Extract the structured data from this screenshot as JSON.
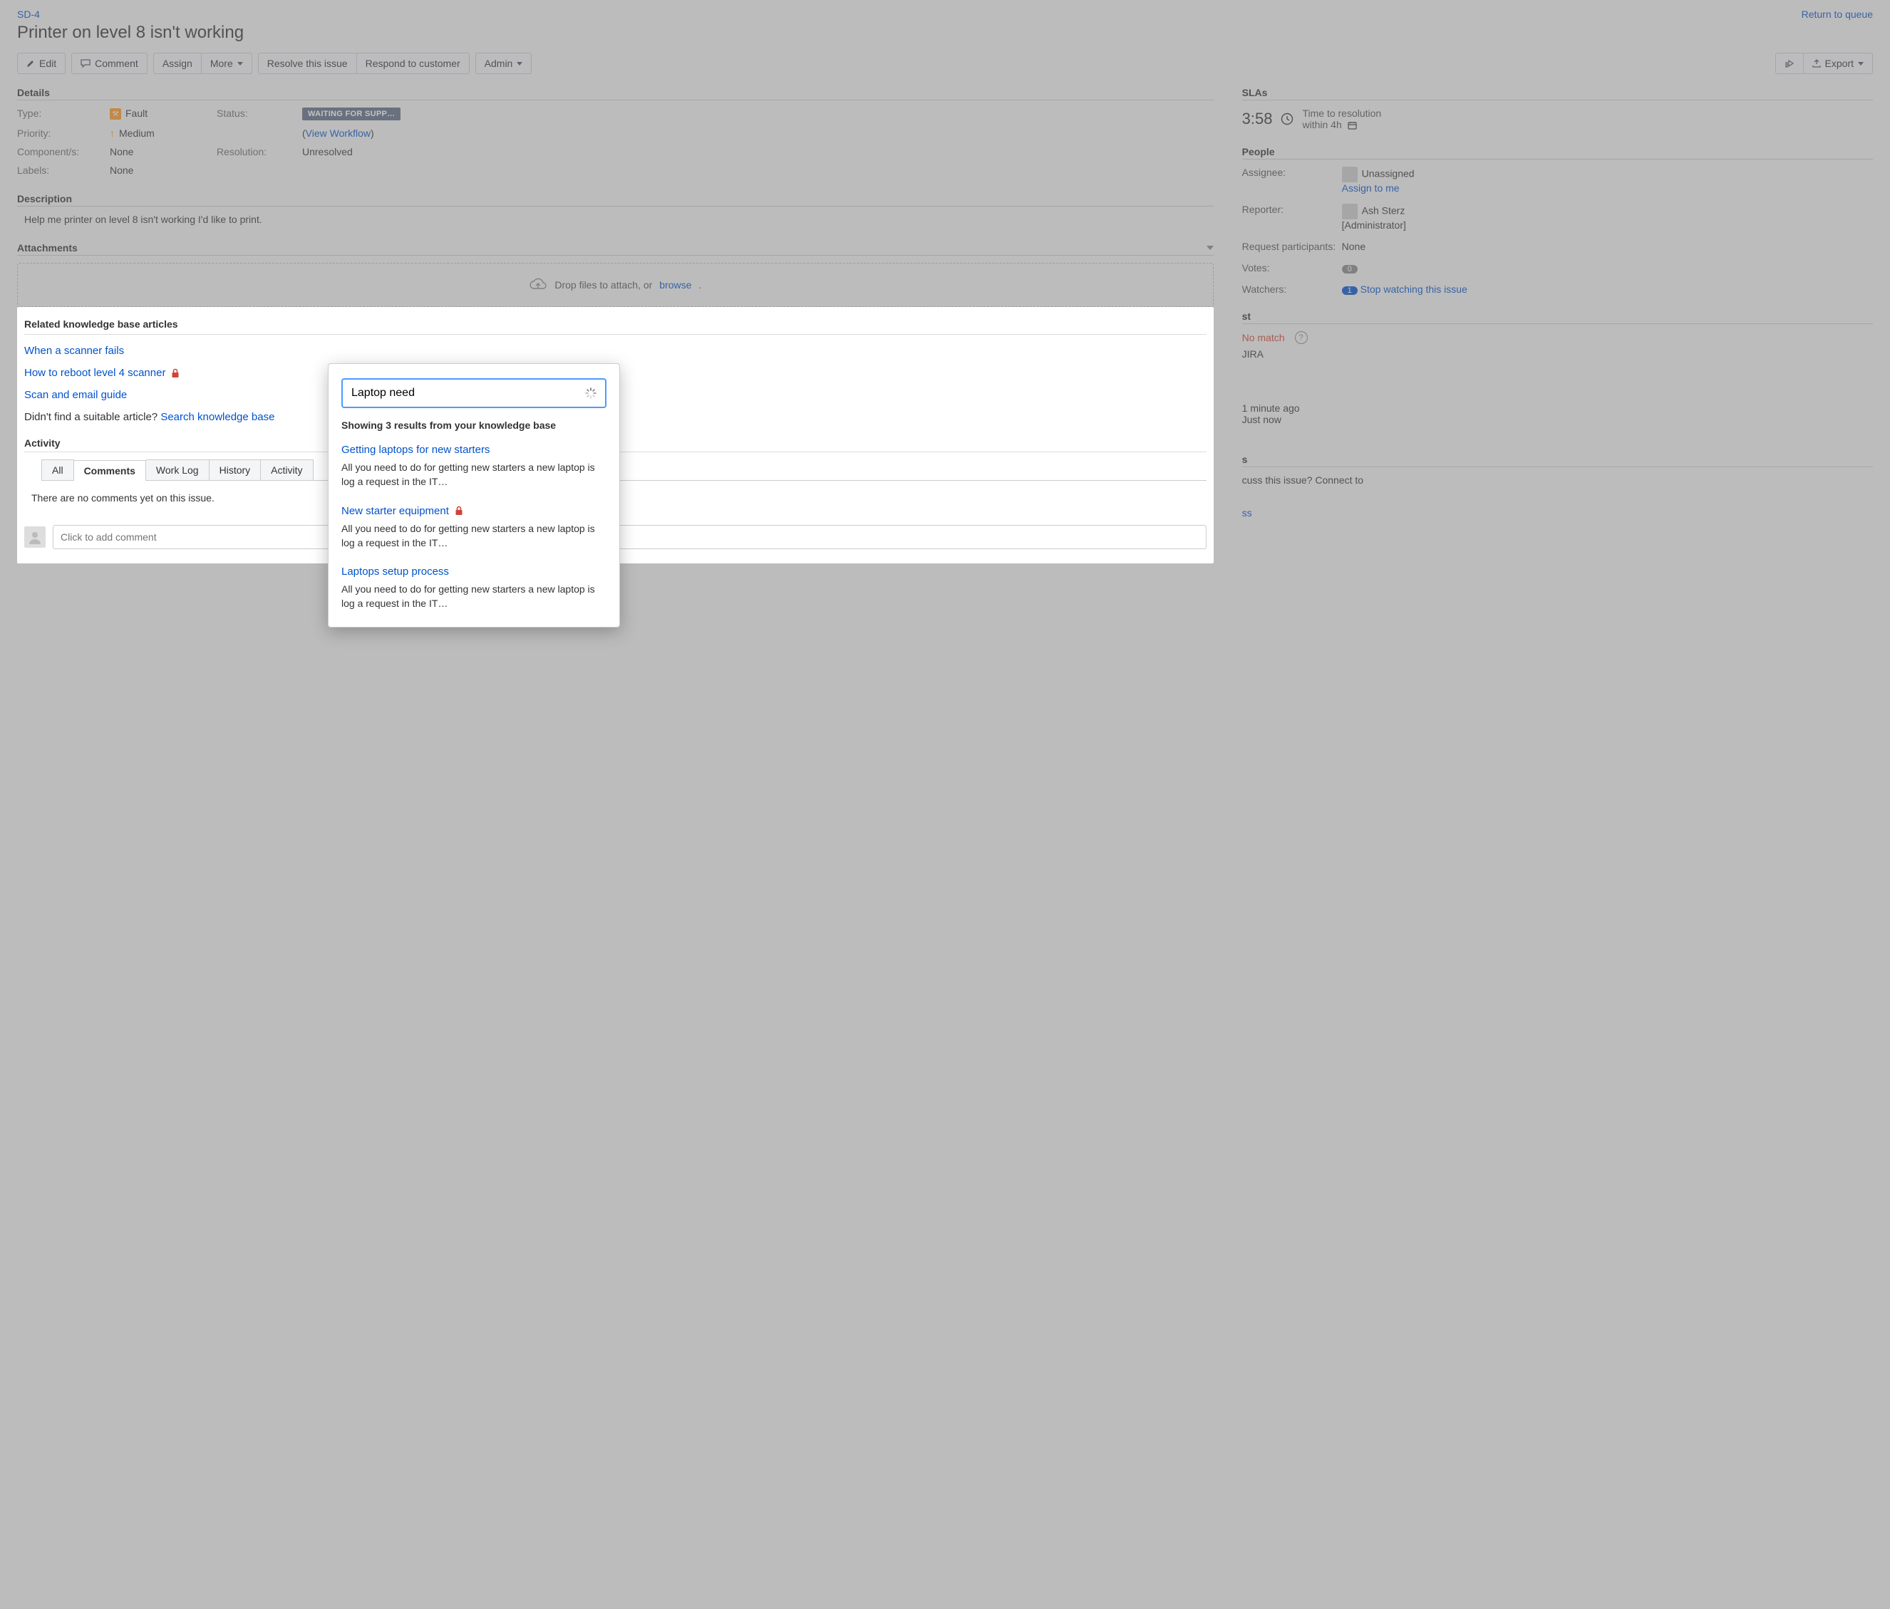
{
  "header": {
    "issue_key": "SD-4",
    "return_link": "Return to queue",
    "title": "Printer on level 8 isn't working"
  },
  "toolbar": {
    "edit": "Edit",
    "comment": "Comment",
    "assign": "Assign",
    "more": "More",
    "resolve": "Resolve this issue",
    "respond": "Respond to customer",
    "admin": "Admin",
    "export": "Export"
  },
  "details": {
    "heading": "Details",
    "type_label": "Type:",
    "type_value": "Fault",
    "status_label": "Status:",
    "status_value": "WAITING FOR SUPP…",
    "workflow_link": "View Workflow",
    "priority_label": "Priority:",
    "priority_value": "Medium",
    "components_label": "Component/s:",
    "components_value": "None",
    "resolution_label": "Resolution:",
    "resolution_value": "Unresolved",
    "labels_label": "Labels:",
    "labels_value": "None"
  },
  "description": {
    "heading": "Description",
    "text": "Help me printer on level 8 isn't working I'd like to print."
  },
  "attachments": {
    "heading": "Attachments",
    "drop_text": "Drop files to attach, or",
    "browse": "browse"
  },
  "kb": {
    "heading": "Related knowledge base articles",
    "items": [
      {
        "title": "When a scanner fails",
        "locked": false
      },
      {
        "title": "How to reboot level 4 scanner",
        "locked": true
      },
      {
        "title": "Scan and email guide",
        "locked": false
      }
    ],
    "prompt_prefix": "Didn't find a suitable article? ",
    "prompt_link": "Search knowledge base"
  },
  "activity": {
    "heading": "Activity",
    "tabs": {
      "all": "All",
      "comments": "Comments",
      "worklog": "Work Log",
      "history": "History",
      "activity": "Activity"
    },
    "empty": "There are no comments yet on this issue.",
    "placeholder": "Click to add comment"
  },
  "sla": {
    "heading": "SLAs",
    "time": "3:58",
    "label": "Time to resolution",
    "within": "within 4h"
  },
  "people": {
    "heading": "People",
    "assignee_label": "Assignee:",
    "assignee_value": "Unassigned",
    "assign_to_me": "Assign to me",
    "reporter_label": "Reporter:",
    "reporter_value": "Ash Sterz",
    "reporter_role": "[Administrator]",
    "participants_label": "Request participants:",
    "participants_value": "None",
    "votes_label": "Votes:",
    "votes_value": "0",
    "watchers_label": "Watchers:",
    "watchers_count": "1",
    "watchers_link": "Stop watching this issue"
  },
  "request": {
    "heading_tail": "st",
    "nomatch": "No match",
    "jira": "JIRA",
    "t1": "1 minute ago",
    "t2": "Just now",
    "tail_s": "s",
    "connect_tail": "cuss this issue? Connect to",
    "ss": "ss"
  },
  "popover": {
    "search_value": "Laptop need",
    "results_heading": "Showing 3 results from your knowledge base",
    "results": [
      {
        "title": "Getting laptops for new starters",
        "locked": false,
        "snippet": "All you need to do for getting new starters a new laptop is log a request in the IT…"
      },
      {
        "title": "New starter equipment",
        "locked": true,
        "snippet": "All you need to do for getting new starters a new laptop is log a request in the IT…"
      },
      {
        "title": "Laptops setup process",
        "locked": false,
        "snippet": "All you need to do for getting new starters a new laptop is log a request in the IT…"
      }
    ]
  }
}
